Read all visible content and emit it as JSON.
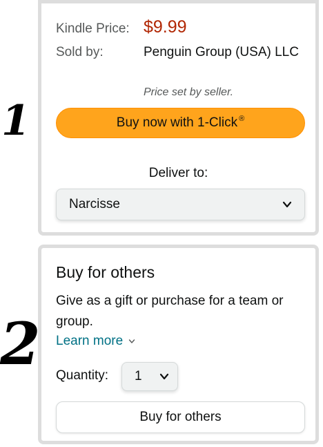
{
  "annotations": {
    "marker_1": "1",
    "marker_2": "2"
  },
  "purchase": {
    "kindle_price_label": "Kindle Price:",
    "kindle_price": "$9.99",
    "sold_by_label": "Sold by:",
    "seller": "Penguin Group (USA) LLC",
    "price_note": "Price set by seller.",
    "buy_button": "Buy now with 1-Click",
    "buy_button_mark": "®",
    "deliver_label": "Deliver to:",
    "deliver_selected": "Narcisse"
  },
  "buy_for_others": {
    "title": "Buy for others",
    "description": "Give as a gift or purchase for a team or group.",
    "learn_more": "Learn more",
    "quantity_label": "Quantity:",
    "quantity_selected": "1",
    "button": "Buy for others"
  },
  "colors": {
    "price": "#b12704",
    "button": "#ffa41c",
    "link": "#007185"
  }
}
